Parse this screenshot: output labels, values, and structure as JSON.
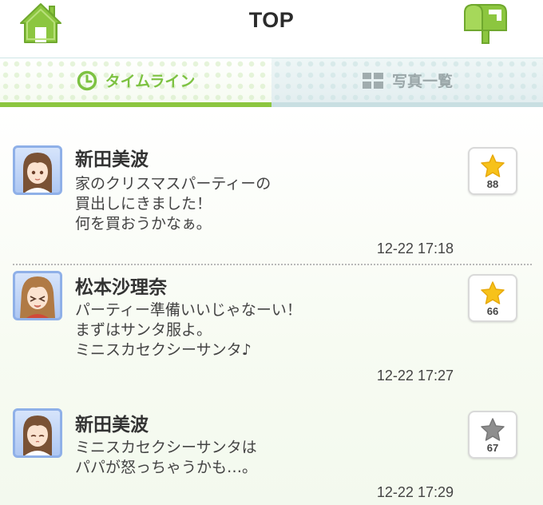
{
  "header": {
    "title": "TOP",
    "home_icon": "home-icon",
    "mail_icon": "mailbox-icon",
    "accent": "#8cc63f"
  },
  "tabs": [
    {
      "label": "タイムライン",
      "icon": "clock-icon",
      "selected": true
    },
    {
      "label": "写真一覧",
      "icon": "grid-icon",
      "selected": false
    }
  ],
  "posts": [
    {
      "name": "新田美波",
      "text": "家のクリスマスパーティーの\n買出しにきました！\n何を買おうかなぁ。",
      "time": "12-22 17:18",
      "likes": "88",
      "liked": true
    },
    {
      "name": "松本沙理奈",
      "text": "パーティー準備いいじゃなーい！\nまずはサンタ服よ。\nミニスカセクシーサンタ♪",
      "time": "12-22 17:27",
      "likes": "66",
      "liked": true
    },
    {
      "name": "新田美波",
      "text": "ミニスカセクシーサンタは\nパパが怒っちゃうかも…。",
      "time": "12-22 17:29",
      "likes": "67",
      "liked": false
    }
  ]
}
